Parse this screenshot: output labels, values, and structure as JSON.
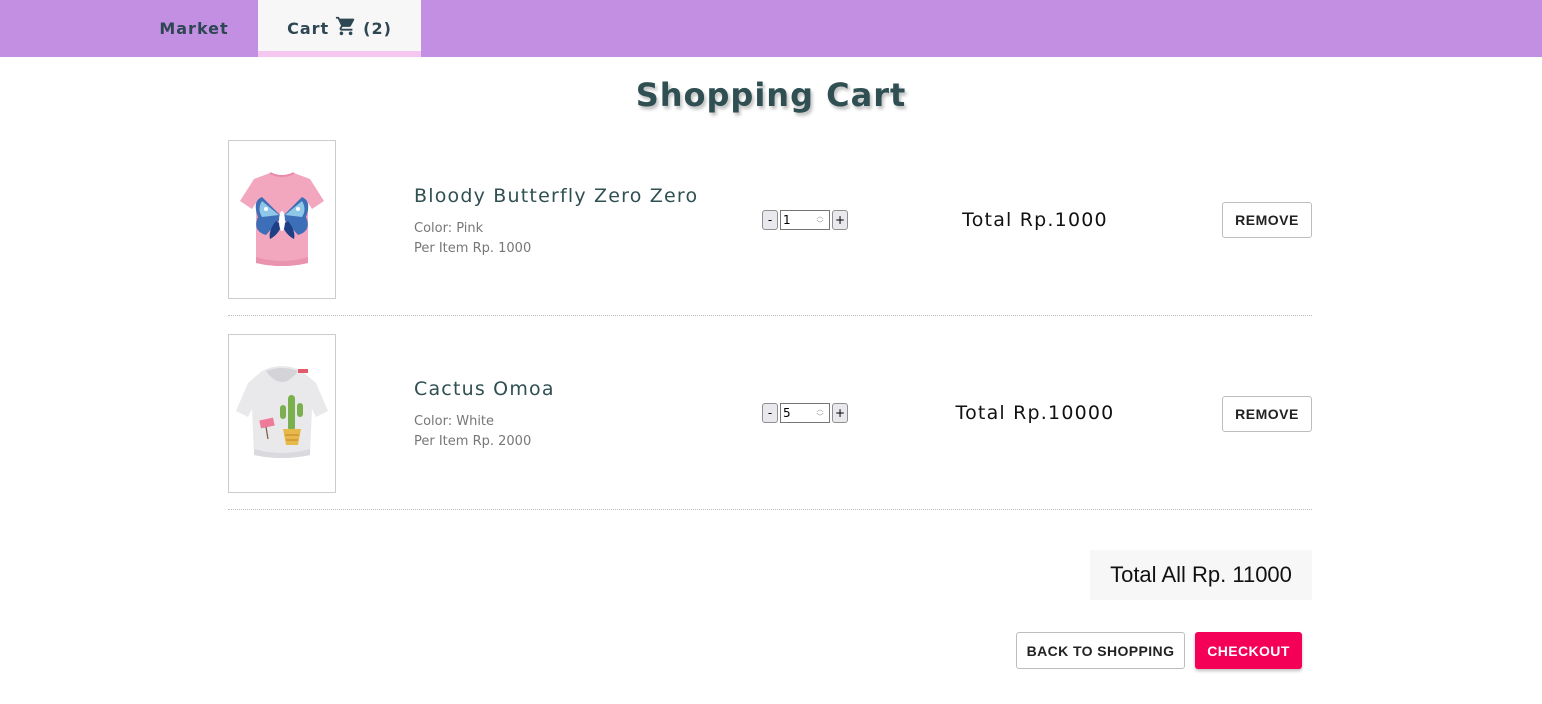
{
  "nav": {
    "market_label": "Market",
    "cart_label": "Cart",
    "cart_icon": "shopping-cart-icon",
    "cart_count": "(2)",
    "bar_color": "#c38fe3"
  },
  "page": {
    "title": "Shopping Cart"
  },
  "cart": {
    "items": [
      {
        "name": "Bloody Butterfly Zero Zero",
        "color_text": "Color: Pink",
        "price_text": "Per Item Rp. 1000",
        "quantity": "1",
        "minus_label": "-",
        "plus_label": "+",
        "total_text": "Total Rp.1000",
        "remove_label": "REMOVE",
        "image": "pink-butterfly-tshirt"
      },
      {
        "name": "Cactus Omoa",
        "color_text": "Color: White",
        "price_text": "Per Item Rp. 2000",
        "quantity": "5",
        "minus_label": "-",
        "plus_label": "+",
        "total_text": "Total Rp.10000",
        "remove_label": "REMOVE",
        "image": "white-cactus-hoodie"
      }
    ],
    "total_all_text": "Total All Rp. 11000"
  },
  "actions": {
    "back_label": "BACK TO SHOPPING",
    "checkout_label": "CHECKOUT",
    "checkout_color": "#f50057"
  }
}
